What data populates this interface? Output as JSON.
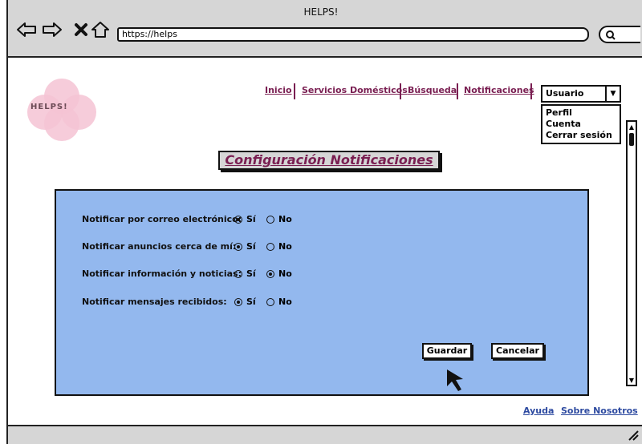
{
  "window": {
    "title": "HELPS!"
  },
  "browser": {
    "url": "https://helps"
  },
  "logo": {
    "text": "HELPS!"
  },
  "nav": {
    "items": [
      {
        "label": "Inicio"
      },
      {
        "label": "Servicios Domésticos"
      },
      {
        "label": "Búsqueda"
      },
      {
        "label": "Notificaciones"
      }
    ]
  },
  "user_menu": {
    "selected": "Usuario",
    "options": [
      "Perfil",
      "Cuenta",
      "Cerrar sesión"
    ]
  },
  "page": {
    "title": "Configuración Notificaciones"
  },
  "settings": {
    "yes_label": "Sí",
    "no_label": "No",
    "rows": [
      {
        "label": "Notificar por correo electrónico:",
        "value": "Sí"
      },
      {
        "label": "Notificar anuncios cerca de mí:",
        "value": "Sí"
      },
      {
        "label": "Notificar información y noticias:",
        "value": "No"
      },
      {
        "label": "Notificar mensajes recibidos:",
        "value": "Sí"
      }
    ]
  },
  "actions": {
    "save": "Guardar",
    "cancel": "Cancelar"
  },
  "footer": {
    "help": "Ayuda",
    "about": "Sobre Nosotros"
  }
}
